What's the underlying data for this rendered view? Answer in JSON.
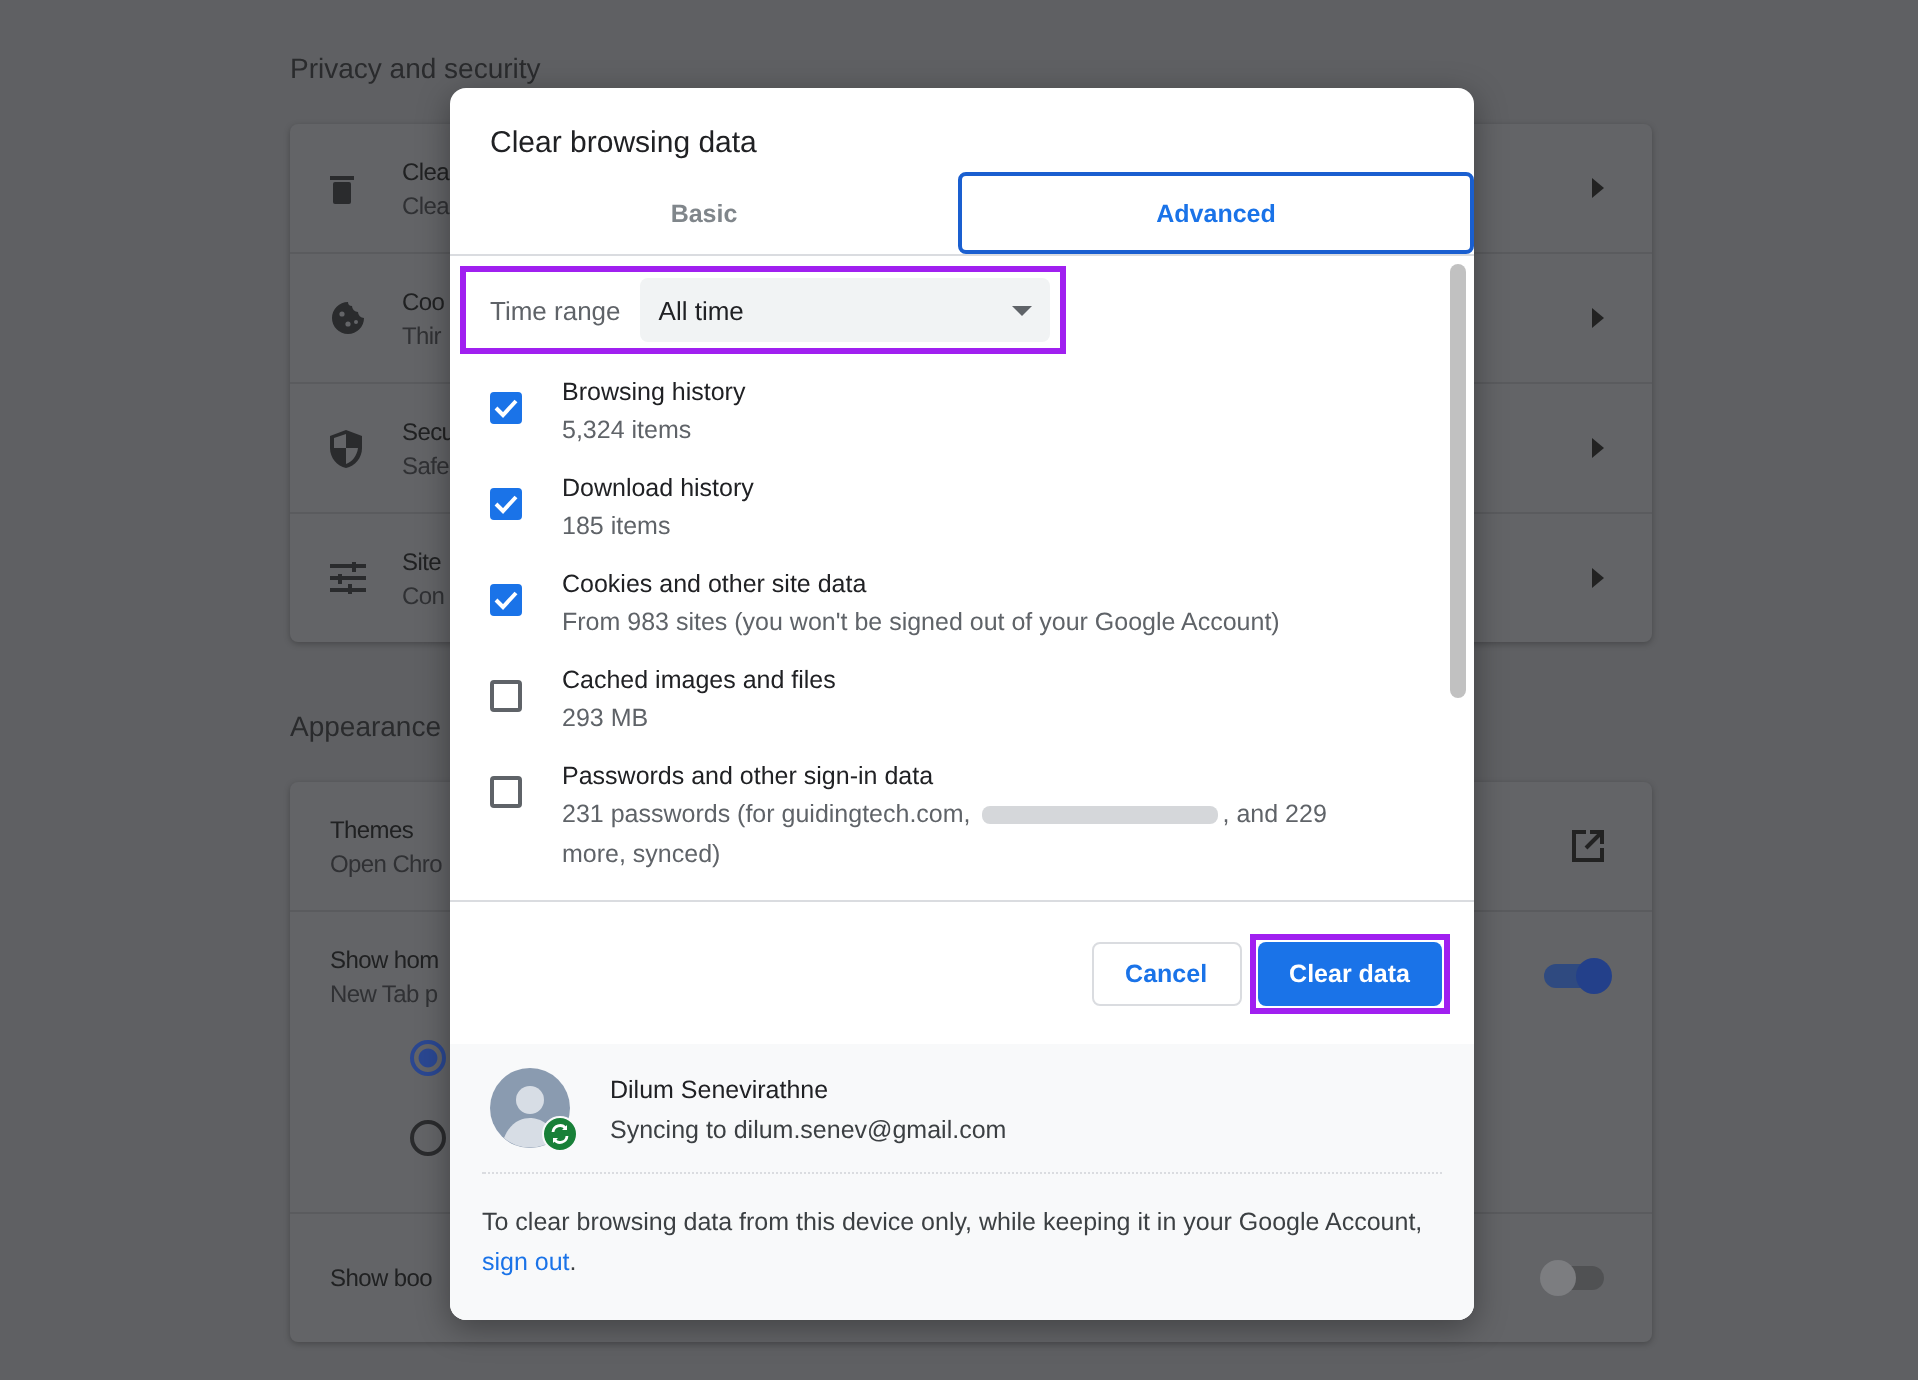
{
  "settings": {
    "sections": [
      {
        "title": "Privacy and security",
        "rows": [
          {
            "title": "Clea",
            "subtitle": "Clea",
            "kind": "arrow"
          },
          {
            "title": "Coo",
            "subtitle": "Thir",
            "kind": "arrow"
          },
          {
            "title": "Secu",
            "subtitle": "Safe",
            "kind": "arrow"
          },
          {
            "title": "Site",
            "subtitle": "Con",
            "kind": "arrow"
          }
        ]
      },
      {
        "title": "Appearance",
        "rows": [
          {
            "title": "Themes",
            "subtitle": "Open Chro",
            "kind": "external"
          },
          {
            "title": "Show hom",
            "subtitle": "New Tab p",
            "kind": "toggle",
            "on": true,
            "radios": [
              {
                "selected": true
              },
              {
                "selected": false
              }
            ]
          },
          {
            "title": "Show boo",
            "kind": "toggle",
            "on": false
          }
        ]
      }
    ]
  },
  "dialog": {
    "title": "Clear browsing data",
    "tabs": [
      {
        "label": "Basic",
        "selected": false
      },
      {
        "label": "Advanced",
        "selected": true
      }
    ],
    "time_range": {
      "label": "Time range",
      "value": "All time"
    },
    "items": [
      {
        "label": "Browsing history",
        "detail": "5,324 items",
        "checked": true
      },
      {
        "label": "Download history",
        "detail": "185 items",
        "checked": true
      },
      {
        "label": "Cookies and other site data",
        "detail": "From 983 sites (you won't be signed out of your Google Account)",
        "checked": true
      },
      {
        "label": "Cached images and files",
        "detail": "293 MB",
        "checked": false
      },
      {
        "label": "Passwords and other sign-in data",
        "detail": "231 passwords (for guidingtech.com,",
        "redacted": true,
        "detail_after": ", and 229 more, synced)",
        "checked": false
      }
    ],
    "buttons": [
      {
        "label": "Cancel",
        "kind": "secondary"
      },
      {
        "label": "Clear data",
        "kind": "primary"
      }
    ],
    "account": {
      "name": "Dilum Senevirathne",
      "status": "Syncing to dilum.senev@gmail.com"
    },
    "note": {
      "text": "To clear browsing data from this device only, while keeping it in your Google Account,",
      "link": "sign out",
      "end": "."
    }
  }
}
